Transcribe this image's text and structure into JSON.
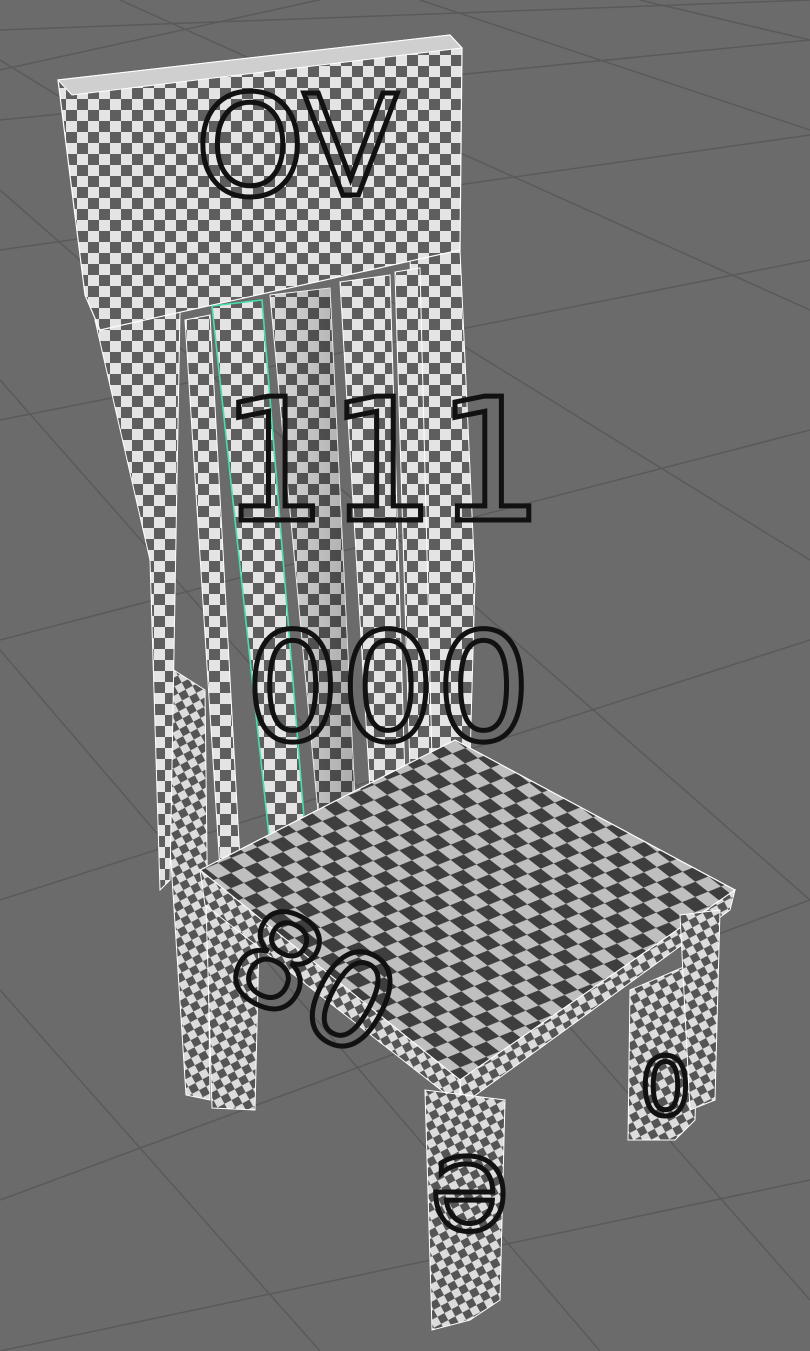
{
  "viewport": {
    "background": "#6b6b6b",
    "grid_color": "#5a5a5a"
  },
  "model": {
    "name": "chair",
    "texture": "checker",
    "checker_light": "#e6e6e6",
    "checker_dark": "#5c5c5c",
    "wire_color": "#ffffff",
    "selection_color": "#46e0a8",
    "selected_part": "back-slat-1"
  },
  "uv_labels": {
    "top_rail": "OV",
    "slats": "111",
    "slats_lower": "000",
    "seat_top": "8",
    "seat_front": "80",
    "leg_front_right": "Ə",
    "leg_back_right": "0"
  }
}
